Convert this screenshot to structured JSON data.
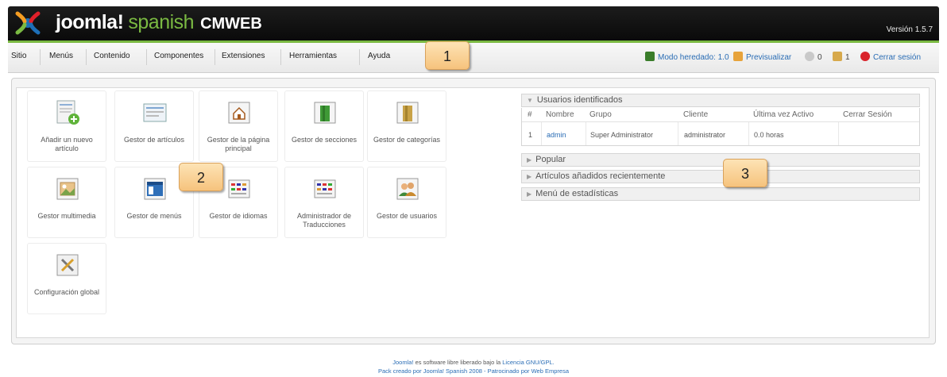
{
  "header": {
    "brand_joomla": "joomla!",
    "brand_spanish": "spanish",
    "brand_cmweb": "CMWEB",
    "version": "Versión 1.5.7"
  },
  "menu": [
    "Sitio",
    "Menús",
    "Contenido",
    "Componentes",
    "Extensiones",
    "Herramientas",
    "Ayuda"
  ],
  "status": {
    "legacy_mode": "Modo heredado: 1.0",
    "preview": "Previsualizar",
    "messages_count": "0",
    "users_count": "1",
    "logout": "Cerrar sesión"
  },
  "callouts": [
    "1",
    "2",
    "3"
  ],
  "icons": [
    {
      "label": "Añadir un nuevo artículo",
      "icon": "add-article-icon"
    },
    {
      "label": "Gestor de artículos",
      "icon": "article-manager-icon"
    },
    {
      "label": "Gestor de la página principal",
      "icon": "frontpage-manager-icon"
    },
    {
      "label": "Gestor de secciones",
      "icon": "section-manager-icon"
    },
    {
      "label": "Gestor de categorías",
      "icon": "category-manager-icon"
    },
    {
      "label": "Gestor multimedia",
      "icon": "media-manager-icon"
    },
    {
      "label": "Gestor de menús",
      "icon": "menu-manager-icon"
    },
    {
      "label": "Gestor de idiomas",
      "icon": "language-manager-icon"
    },
    {
      "label": "Administrador de Traducciones",
      "icon": "translation-manager-icon"
    },
    {
      "label": "Gestor de usuarios",
      "icon": "user-manager-icon"
    },
    {
      "label": "Configuración global",
      "icon": "global-config-icon"
    }
  ],
  "logged_users": {
    "title": "Usuarios identificados",
    "columns": [
      "#",
      "Nombre",
      "Grupo",
      "Cliente",
      "Última vez Activo",
      "Cerrar Sesión"
    ],
    "rows": [
      [
        "1",
        "admin",
        "Super Administrator",
        "administrator",
        "0.0 horas",
        ""
      ]
    ]
  },
  "panels": [
    "Popular",
    "Artículos añadidos recientemente",
    "Menú de estadísticas"
  ],
  "footer": {
    "line1_joomla": "Joomla!",
    "line1_text": " es software libre liberado bajo la ",
    "line1_license": "Licencia GNU/GPL.",
    "line2": "Pack creado por Joomla! Spanish 2008 - Patrocinado por Web Empresa"
  },
  "colors": {
    "header_bg": "#111111",
    "accent_green": "#7ab942",
    "link_blue": "#2a6db5",
    "callout_fill": "#f6c37d"
  }
}
